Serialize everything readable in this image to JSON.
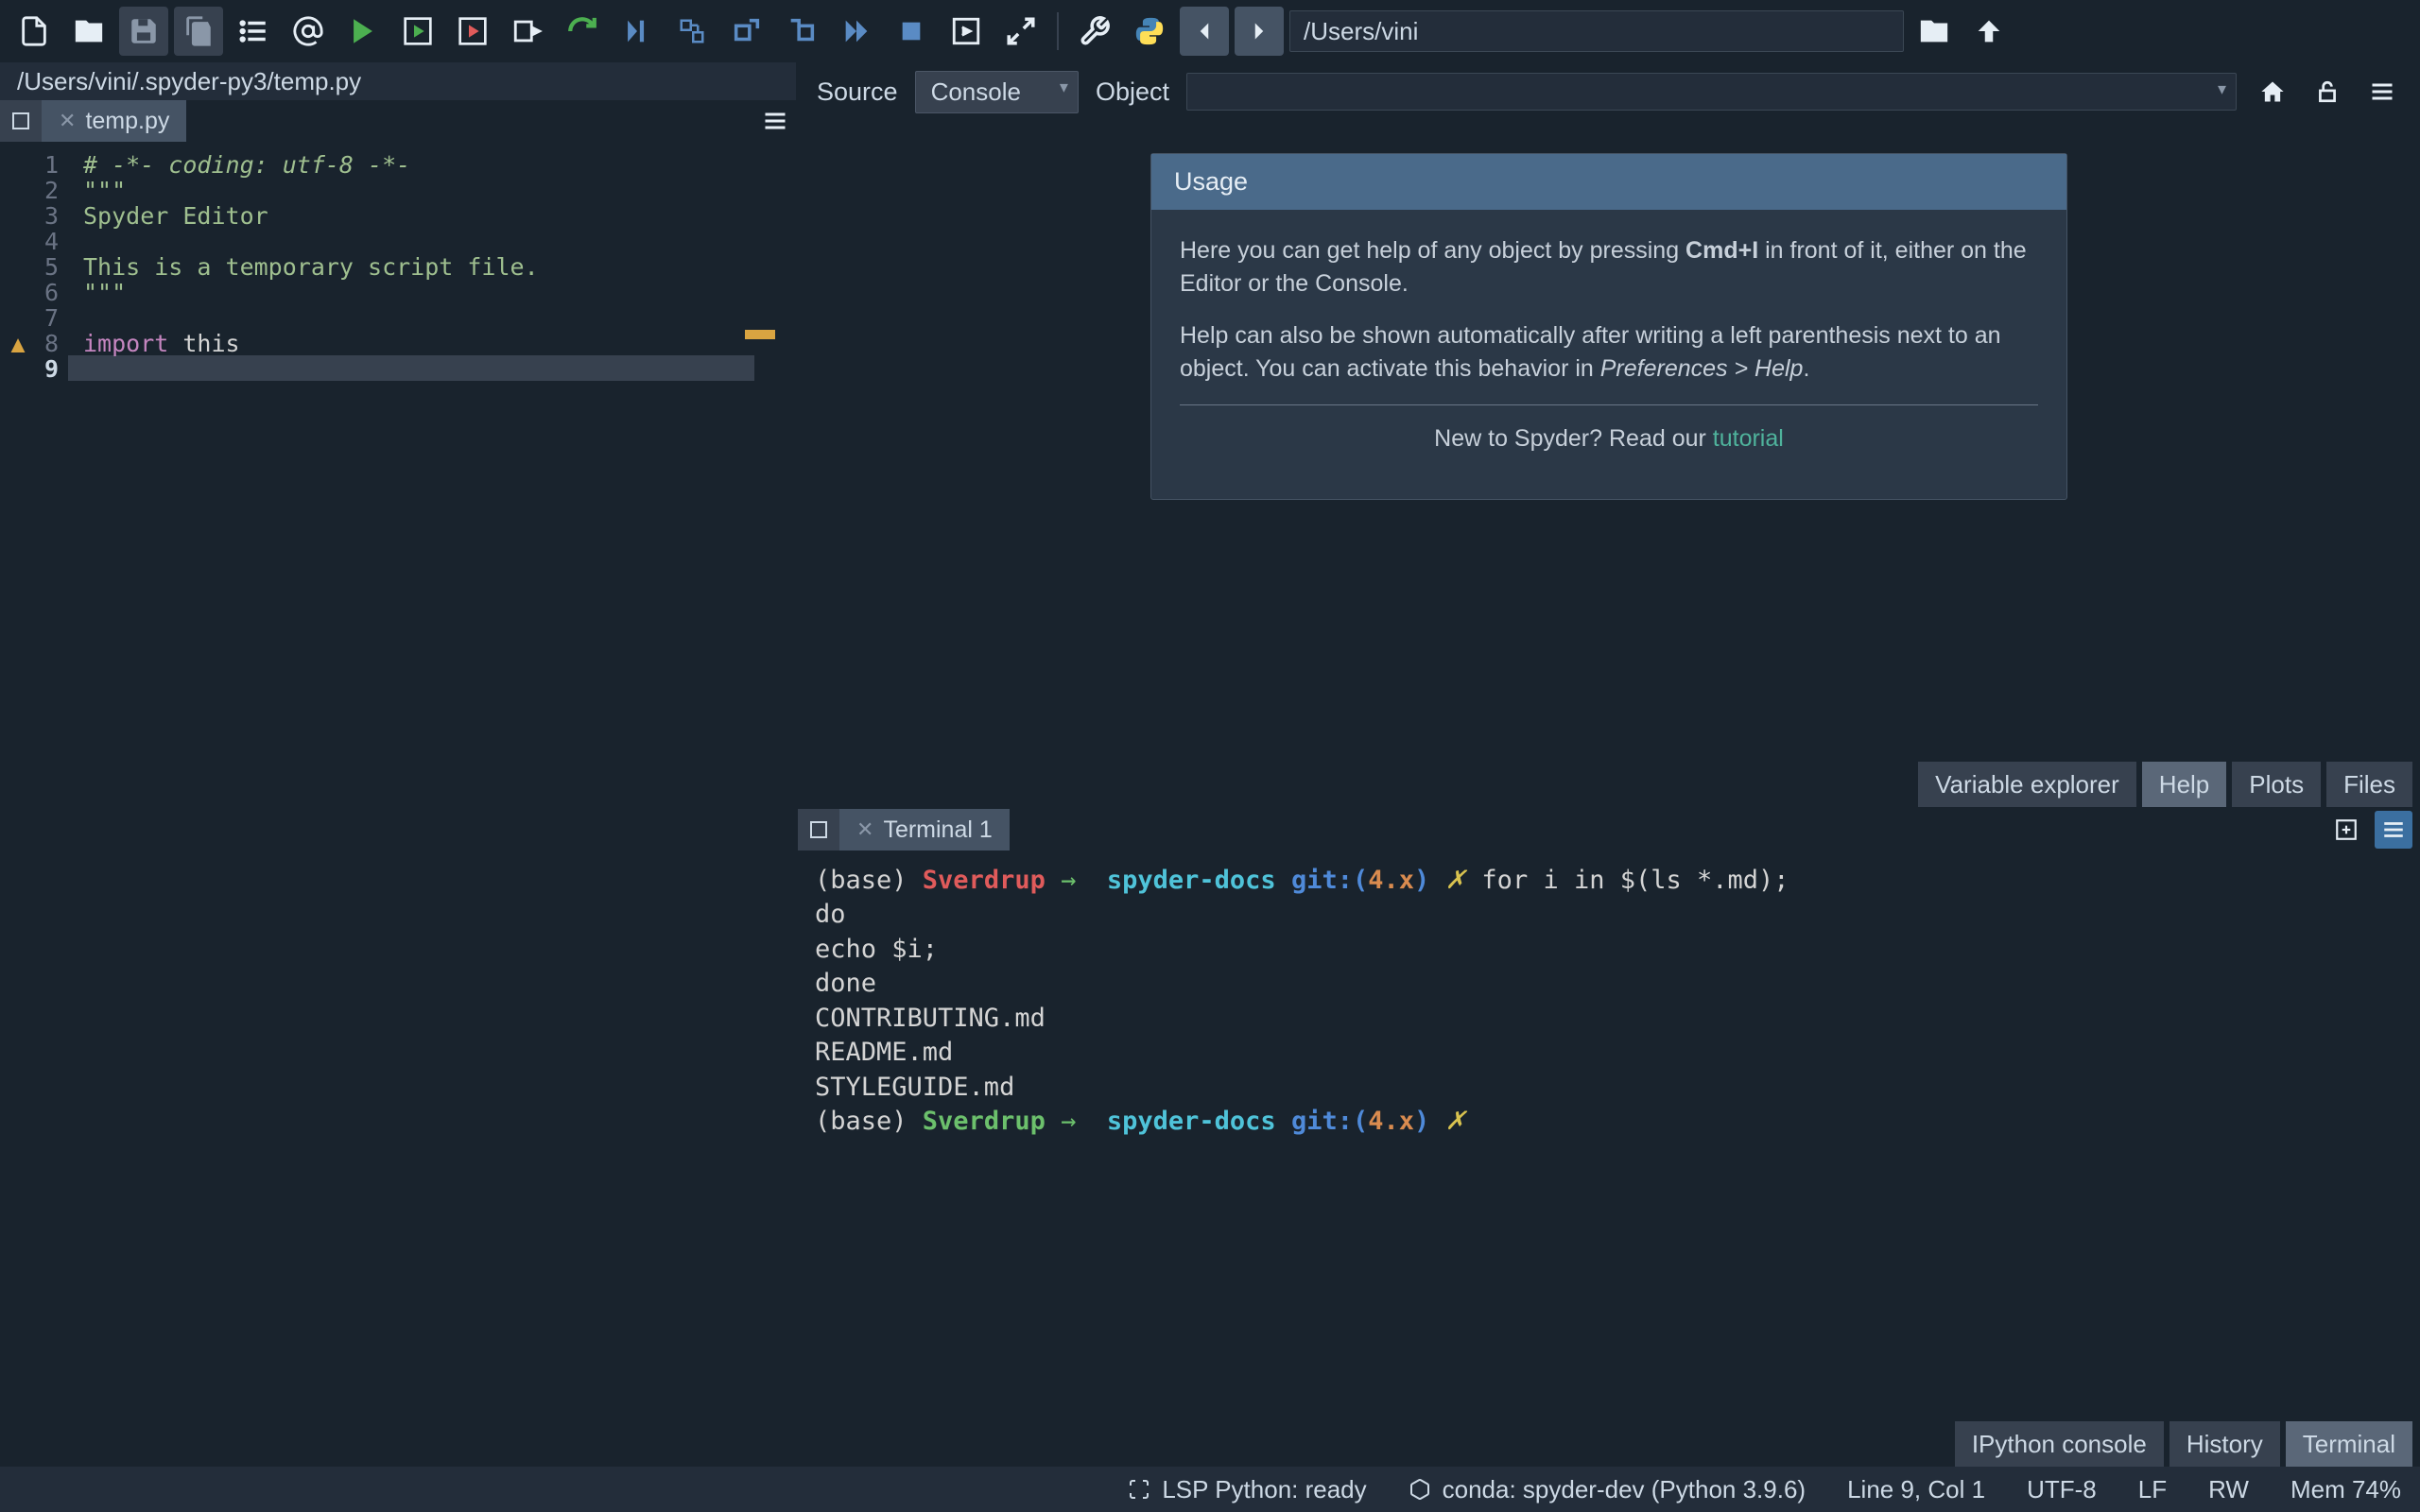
{
  "toolbar": {
    "path": "/Users/vini"
  },
  "editor": {
    "path": "/Users/vini/.spyder-py3/temp.py",
    "tab": "temp.py",
    "lines": [
      {
        "n": 1,
        "type": "comment",
        "text": "# -*- coding: utf-8 -*-"
      },
      {
        "n": 2,
        "type": "string",
        "text": "\"\"\""
      },
      {
        "n": 3,
        "type": "string",
        "text": "Spyder Editor"
      },
      {
        "n": 4,
        "type": "string",
        "text": ""
      },
      {
        "n": 5,
        "type": "string",
        "text": "This is a temporary script file."
      },
      {
        "n": 6,
        "type": "string",
        "text": "\"\"\""
      },
      {
        "n": 7,
        "type": "plain",
        "text": ""
      },
      {
        "n": 8,
        "type": "import",
        "kw": "import",
        "rest": " this"
      },
      {
        "n": 9,
        "type": "plain",
        "text": ""
      }
    ]
  },
  "help": {
    "source_label": "Source",
    "source_value": "Console",
    "object_label": "Object",
    "card_title": "Usage",
    "p1_pre": "Here you can get help of any object by pressing ",
    "p1_key": "Cmd+I",
    "p1_post": " in front of it, either on the Editor or the Console.",
    "p2_pre": "Help can also be shown automatically after writing a left parenthesis next to an object. You can activate this behavior in ",
    "p2_em": "Preferences > Help",
    "p2_post": ".",
    "footer_pre": "New to Spyder? Read our ",
    "footer_link": "tutorial"
  },
  "help_tabs": [
    "Variable explorer",
    "Help",
    "Plots",
    "Files"
  ],
  "terminal": {
    "tab": "Terminal 1",
    "base": "(base) ",
    "host_red": "Sverdrup",
    "host_green": "Sverdrup",
    "arrow": " → ",
    "dir": " spyder-docs ",
    "git": "git:(",
    "branch": "4.x",
    "gitclose": ")",
    "dirty": " ✗",
    "cmd1b": " for i in $(ls *.md);",
    "l2": "do",
    "l3": "echo $i;",
    "l4": "done",
    "out1": "CONTRIBUTING.md",
    "out2": "README.md",
    "out3": "STYLEGUIDE.md"
  },
  "bottom_tabs": [
    "IPython console",
    "History",
    "Terminal"
  ],
  "status": {
    "lsp": "LSP Python: ready",
    "conda": "conda: spyder-dev (Python 3.9.6)",
    "pos": "Line 9, Col 1",
    "enc": "UTF-8",
    "eol": "LF",
    "perm": "RW",
    "mem": "Mem 74%"
  }
}
